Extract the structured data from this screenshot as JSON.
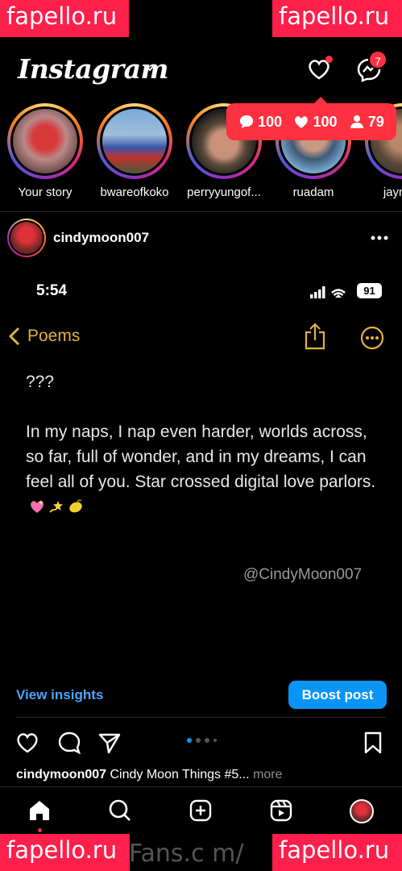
{
  "watermarks": {
    "top_left": "fapello.ru",
    "top_right": "fapello.ru",
    "bottom_left": "fapello.ru",
    "bottom_right": "fapello.ru",
    "center": "Fans.c m/"
  },
  "header": {
    "logo": "Instagram",
    "messages_badge": "7"
  },
  "activity_popup": {
    "comments": "100",
    "likes": "100",
    "followers": "79"
  },
  "stories": [
    {
      "name": "Your story"
    },
    {
      "name": "bwareofkoko"
    },
    {
      "name": "perryyungof..."
    },
    {
      "name": "ruadam"
    },
    {
      "name": "jaymon"
    }
  ],
  "post": {
    "username": "cindymoon007",
    "screenshot": {
      "time": "5:54",
      "battery": "91",
      "back_label": "Poems",
      "line1": "???",
      "body": "In my naps, I nap even harder, worlds across, so far, full of wonder, and in my dreams, I can feel all of you. Star crossed digital love parlors.",
      "handle": "@CindyMoon007"
    },
    "insights_label": "View insights",
    "boost_label": "Boost post",
    "caption_user": "cindymoon007",
    "caption_text": "Cindy Moon Things #5...",
    "caption_more": "more"
  },
  "colors": {
    "accent_blue": "#0a95f6",
    "notification_red": "#ff3040",
    "notes_gold": "#e5b03c"
  }
}
